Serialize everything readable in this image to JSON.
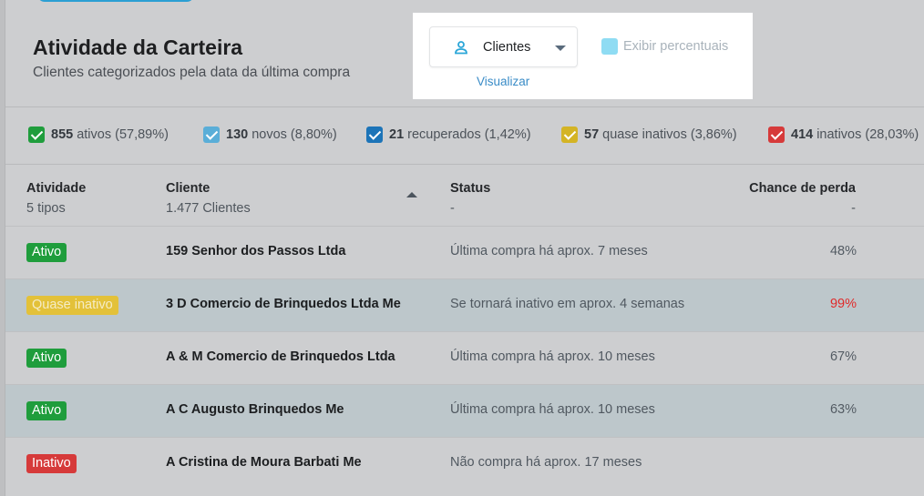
{
  "header": {
    "title": "Atividade da Carteira",
    "subtitle": "Clientes categorizados pela data da última compra"
  },
  "view": {
    "selected": "Clientes",
    "caption": "Visualizar",
    "icon": "user-icon",
    "percent_toggle_label": "Exibir percentuais"
  },
  "filters": [
    {
      "count": "855",
      "label": "ativos (57,89%)",
      "color": "#1f9d3c"
    },
    {
      "count": "130",
      "label": "novos (8,80%)",
      "color": "#5aaed8"
    },
    {
      "count": "21",
      "label": "recuperados (1,42%)",
      "color": "#1c74b8"
    },
    {
      "count": "57",
      "label": "quase inativos (3,86%)",
      "color": "#d4b425"
    },
    {
      "count": "414",
      "label": "inativos (28,03%)",
      "color": "#d63a3a"
    }
  ],
  "table": {
    "columns": [
      {
        "title": "Atividade",
        "sub": "5 tipos"
      },
      {
        "title": "Cliente",
        "sub": "1.477 Clientes"
      },
      {
        "title": "Status",
        "sub": "-"
      },
      {
        "title": "Chance de perda",
        "sub": "-"
      }
    ],
    "rows": [
      {
        "activity": "Ativo",
        "activity_color": "#1f9d3c",
        "activity_text_color": "#ffffff",
        "client": "159 Senhor dos Passos Ltda",
        "status": "Última compra há aprox. 7 meses",
        "chance": "48%",
        "chance_color": "#535b63"
      },
      {
        "activity": "Quase inativo",
        "activity_color": "#e3c139",
        "activity_text_color": "#f5ecc5",
        "client": "3 D Comercio de Brinquedos Ltda Me",
        "status": "Se tornará inativo em aprox. 4 semanas",
        "chance": "99%",
        "chance_color": "#e02a2a"
      },
      {
        "activity": "Ativo",
        "activity_color": "#1f9d3c",
        "activity_text_color": "#ffffff",
        "client": "A & M Comercio de Brinquedos Ltda",
        "status": "Última compra há aprox. 10 meses",
        "chance": "67%",
        "chance_color": "#535b63"
      },
      {
        "activity": "Ativo",
        "activity_color": "#1f9d3c",
        "activity_text_color": "#ffffff",
        "client": "A C Augusto Brinquedos Me",
        "status": "Última compra há aprox. 10 meses",
        "chance": "63%",
        "chance_color": "#535b63"
      },
      {
        "activity": "Inativo",
        "activity_color": "#d63a3a",
        "activity_text_color": "#ffffff",
        "client": "A Cristina de Moura Barbati Me",
        "status": "Não compra há aprox. 17 meses",
        "chance": "",
        "chance_color": "#535b63"
      }
    ]
  }
}
